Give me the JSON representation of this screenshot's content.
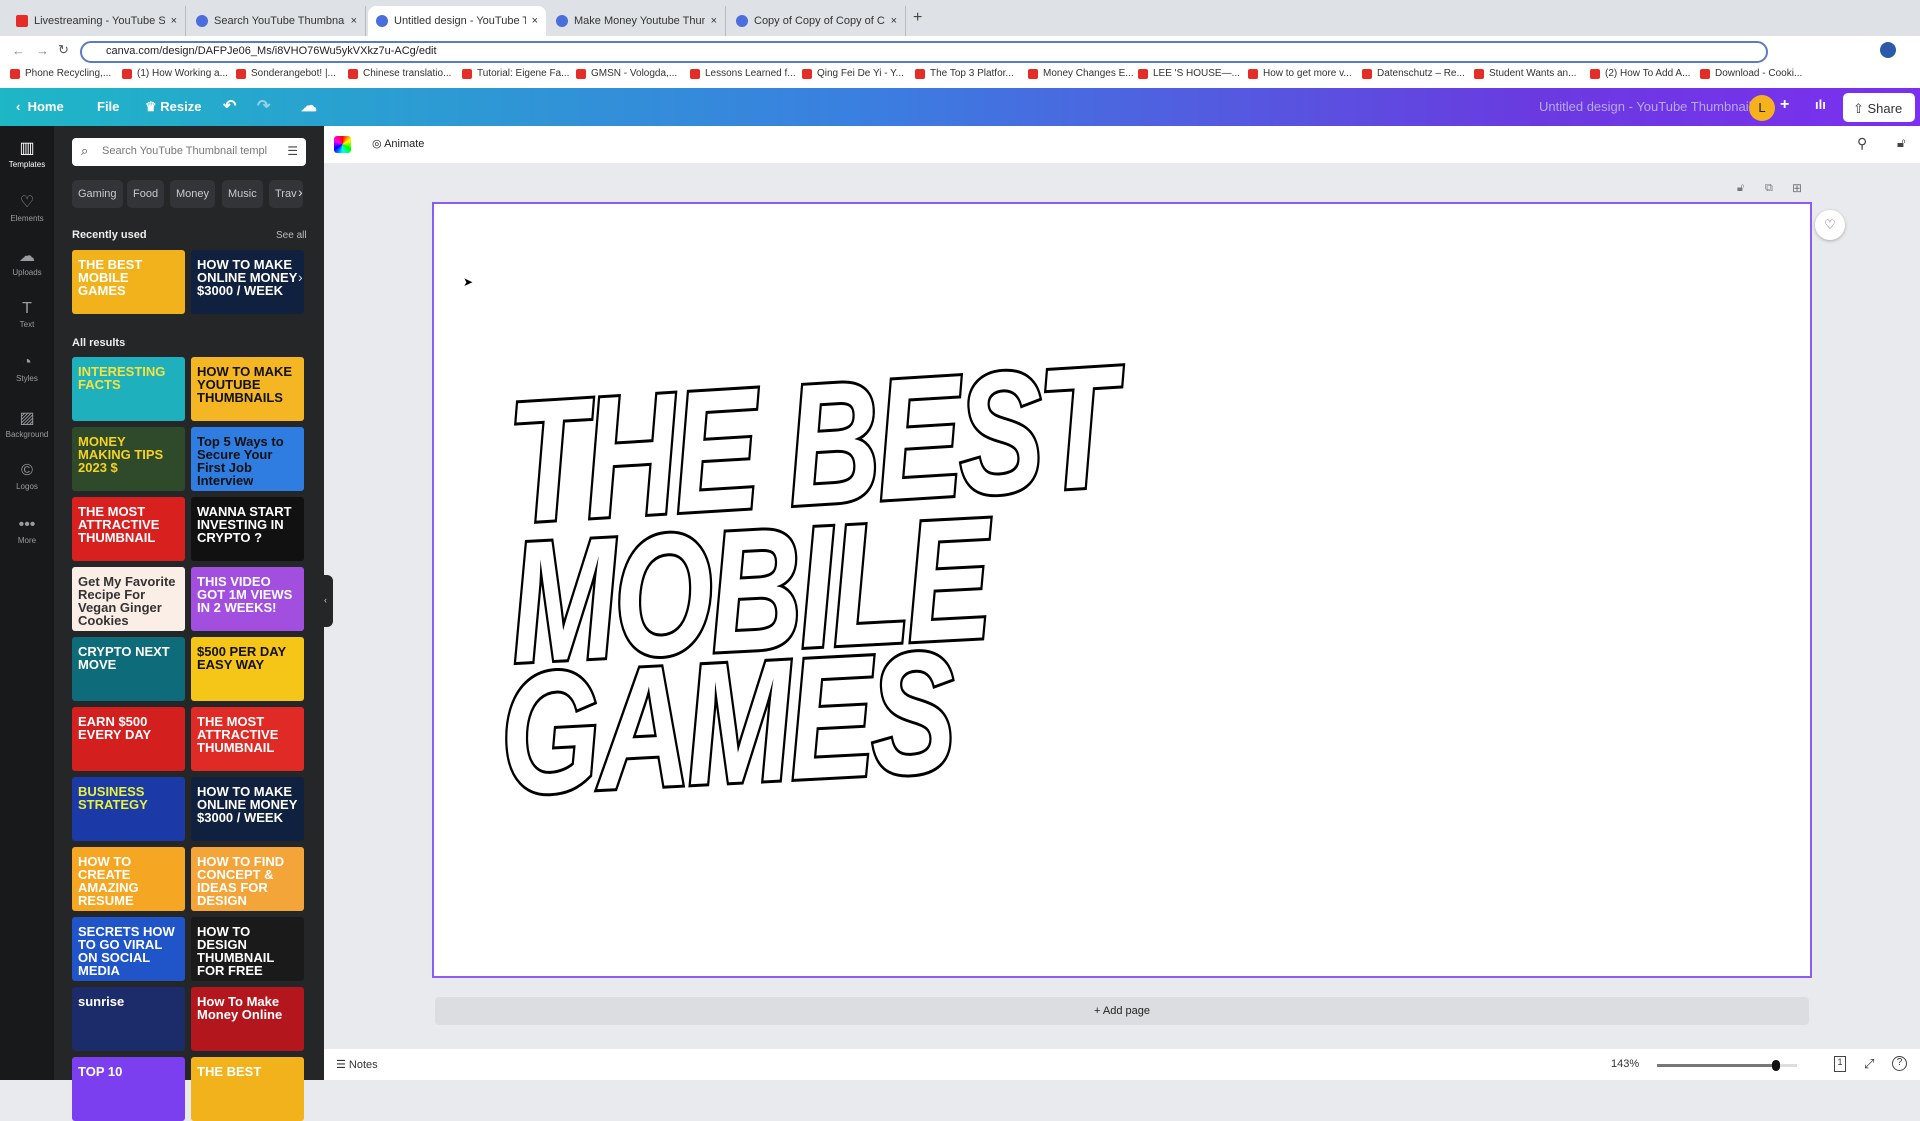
{
  "browser": {
    "tabs": [
      {
        "title": "Livestreaming - YouTube S",
        "icon": "youtube"
      },
      {
        "title": "Search YouTube Thumbnail - C",
        "icon": "canva"
      },
      {
        "title": "Untitled design - YouTube Thu",
        "icon": "canva",
        "active": true
      },
      {
        "title": "Make Money Youtube Thumbn",
        "icon": "canva"
      },
      {
        "title": "Copy of Copy of Copy of Copy",
        "icon": "canva"
      }
    ],
    "url": "canva.com/design/DAFPJe06_Ms/i8VHO76Wu5ykVXkz7u-ACg/edit",
    "bookmarks": [
      "Phone Recycling,...",
      "(1) How Working a...",
      "Sonderangebot! |...",
      "Chinese translatio...",
      "Tutorial: Eigene Fa...",
      "GMSN - Vologda,...",
      "Lessons Learned f...",
      "Qing Fei De Yi - Y...",
      "The Top 3 Platfor...",
      "Money Changes E...",
      "LEE 'S HOUSE—...",
      "How to get more v...",
      "Datenschutz – Re...",
      "Student Wants an...",
      "(2) How To Add A...",
      "Download - Cooki..."
    ]
  },
  "header": {
    "home": "Home",
    "file": "File",
    "resize": "Resize",
    "title": "Untitled design - YouTube Thumbnail",
    "avatar": "L",
    "share": "Share"
  },
  "rail": [
    {
      "label": "Templates",
      "glyph": "▥"
    },
    {
      "label": "Elements",
      "glyph": "♡"
    },
    {
      "label": "Uploads",
      "glyph": "☁"
    },
    {
      "label": "Text",
      "glyph": "T"
    },
    {
      "label": "Styles",
      "glyph": "◔"
    },
    {
      "label": "Background",
      "glyph": "▨"
    },
    {
      "label": "Logos",
      "glyph": "©"
    },
    {
      "label": "More",
      "glyph": "•••"
    }
  ],
  "panel": {
    "search_placeholder": "Search YouTube Thumbnail templ",
    "chips": [
      "Gaming",
      "Food",
      "Money",
      "Music",
      "Trav"
    ],
    "recently_used": "Recently used",
    "see_all": "See all",
    "all_results": "All results",
    "recent": [
      {
        "text": "THE BEST MOBILE GAMES",
        "bg": "#f2b21b",
        "fg": "#fff"
      },
      {
        "text": "HOW TO MAKE ONLINE MONEY $3000 / WEEK",
        "bg": "#10213f",
        "fg": "#fff"
      }
    ],
    "results": [
      {
        "text": "INTERESTING FACTS",
        "bg": "#1fb0bd",
        "fg": "#f7e23a"
      },
      {
        "text": "HOW TO MAKE YOUTUBE THUMBNAILS",
        "bg": "#f4b623",
        "fg": "#111"
      },
      {
        "text": "MONEY MAKING TIPS 2023 $",
        "bg": "#2f4a2a",
        "fg": "#f5d320"
      },
      {
        "text": "Top 5 Ways to Secure Your First Job Interview",
        "bg": "#2f7de0",
        "fg": "#111"
      },
      {
        "text": "THE MOST ATTRACTIVE THUMBNAIL",
        "bg": "#d8201f",
        "fg": "#fff"
      },
      {
        "text": "WANNA START INVESTING IN CRYPTO ?",
        "bg": "#111",
        "fg": "#fff"
      },
      {
        "text": "Get My Favorite Recipe For Vegan Ginger Cookies",
        "bg": "#fbeee6",
        "fg": "#333"
      },
      {
        "text": "THIS VIDEO GOT 1M VIEWS IN 2 WEEKS!",
        "bg": "#a24fe0",
        "fg": "#fff"
      },
      {
        "text": "CRYPTO NEXT MOVE",
        "bg": "#0d6b7a",
        "fg": "#fff"
      },
      {
        "text": "$500 PER DAY EASY WAY",
        "bg": "#f5c518",
        "fg": "#111"
      },
      {
        "text": "EARN $500 EVERY DAY",
        "bg": "#d41f1f",
        "fg": "#fff"
      },
      {
        "text": "THE MOST ATTRACTIVE THUMBNAIL",
        "bg": "#e02a25",
        "fg": "#fff"
      },
      {
        "text": "BUSINESS STRATEGY",
        "bg": "#1b3aa8",
        "fg": "#e7f23a"
      },
      {
        "text": "HOW TO MAKE ONLINE MONEY $3000 / WEEK",
        "bg": "#10213f",
        "fg": "#fff"
      },
      {
        "text": "HOW TO CREATE AMAZING RESUME",
        "bg": "#f5a623",
        "fg": "#fff"
      },
      {
        "text": "HOW TO FIND CONCEPT & IDEAS FOR DESIGN",
        "bg": "#f3a53a",
        "fg": "#fff"
      },
      {
        "text": "SECRETS HOW TO GO VIRAL ON SOCIAL MEDIA",
        "bg": "#1f55c8",
        "fg": "#fff"
      },
      {
        "text": "HOW TO DESIGN THUMBNAIL FOR FREE",
        "bg": "#1a1a1a",
        "fg": "#fff"
      },
      {
        "text": "sunrise",
        "bg": "#1c2b6a",
        "fg": "#fff"
      },
      {
        "text": "How To Make Money Online",
        "bg": "#b3161c",
        "fg": "#fff"
      },
      {
        "text": "TOP 10",
        "bg": "#7b3ff0",
        "fg": "#fff"
      },
      {
        "text": "THE BEST",
        "bg": "#f2b21b",
        "fg": "#fff"
      }
    ]
  },
  "toolbar": {
    "animate": "Animate"
  },
  "canvas": {
    "lines": [
      "THE BEST",
      "MOBILE",
      "GAMES"
    ],
    "add_page": "+ Add page"
  },
  "footer": {
    "notes": "Notes",
    "zoom": "143%",
    "zoom_slider_fraction": 0.85,
    "page_count": "1"
  }
}
